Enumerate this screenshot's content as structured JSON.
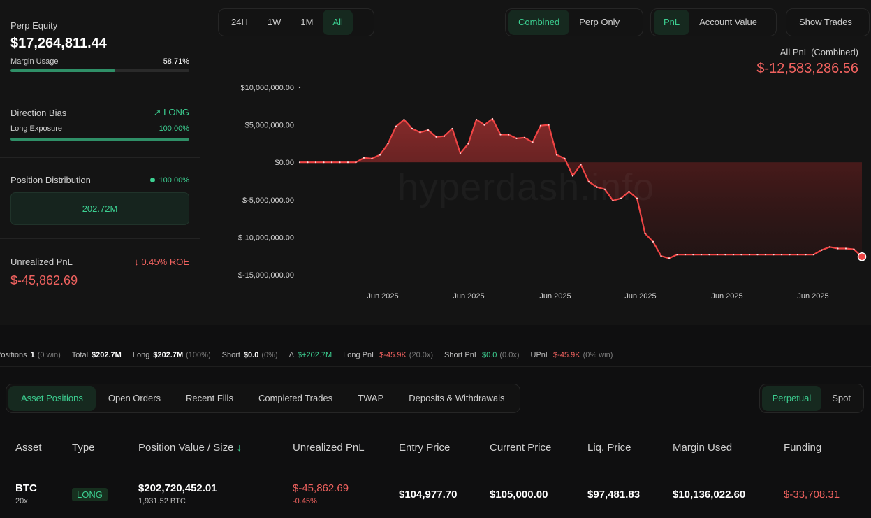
{
  "left": {
    "equity_label": "Perp Equity",
    "equity_value": "$17,264,811.44",
    "margin_label": "Margin Usage",
    "margin_value": "58.71%",
    "margin_fraction": 0.5871,
    "bias_label": "Direction Bias",
    "bias_value": "LONG",
    "long_exposure_label": "Long Exposure",
    "long_exposure_value": "100.00%",
    "long_exposure_fraction": 1.0,
    "dist_label": "Position Distribution",
    "dist_pct": "100.00%",
    "dist_box": "202.72M",
    "upnl_label": "Unrealized PnL",
    "upnl_roe": "0.45% ROE",
    "upnl_value": "$-45,862.69"
  },
  "timeframes": [
    "24H",
    "1W",
    "1M",
    "All"
  ],
  "timeframe_active": "All",
  "modes": [
    "Combined",
    "Perp Only"
  ],
  "mode_active": "Combined",
  "metrics": [
    "PnL",
    "Account Value"
  ],
  "metric_active": "PnL",
  "show_trades": "Show Trades",
  "pnl_header": {
    "title": "All PnL (Combined)",
    "value": "$-12,583,286.56"
  },
  "watermark": "hyperdash.info",
  "chart_data": {
    "type": "area",
    "title": "",
    "y_tick_labels": [
      "$10,000,000.00",
      "$5,000,000.00",
      "$0.00",
      "$-5,000,000.00",
      "$-10,000,000.00",
      "$-15,000,000.00"
    ],
    "y_ticks": [
      10000000,
      5000000,
      0,
      -5000000,
      -10000000,
      -15000000
    ],
    "ylim": [
      -15000000,
      10000000
    ],
    "x_tick_labels": [
      "Jun 2025",
      "Jun 2025",
      "Jun 2025",
      "Jun 2025",
      "Jun 2025",
      "Jun 2025"
    ],
    "series": [
      {
        "values": [
          0,
          0,
          0,
          0,
          0,
          0,
          0,
          0,
          600000,
          500000,
          1000000,
          2500000,
          4800000,
          5700000,
          4500000,
          4000000,
          4300000,
          3400000,
          3500000,
          4500000,
          1200000,
          2500000,
          5700000,
          5000000,
          5800000,
          3700000,
          3700000,
          3200000,
          3300000,
          2700000,
          4900000,
          5000000,
          1000000,
          500000,
          -1800000,
          -300000,
          -2600000,
          -3300000,
          -3600000,
          -5100000,
          -4800000,
          -3900000,
          -4800000,
          -9500000,
          -10600000,
          -12500000,
          -12800000,
          -12300000,
          -12300000,
          -12300000,
          -12300000,
          -12300000,
          -12300000,
          -12300000,
          -12300000,
          -12300000,
          -12300000,
          -12300000,
          -12300000,
          -12300000,
          -12300000,
          -12300000,
          -12300000,
          -12300000,
          -12300000,
          -11700000,
          -11300000,
          -11500000,
          -11500000,
          -11600000,
          -12600000
        ]
      }
    ]
  },
  "summary": {
    "positions_label": "Positions",
    "positions_value": "1",
    "positions_note": "(0 win)",
    "total_label": "Total",
    "total_value": "$202.7M",
    "long_label": "Long",
    "long_value": "$202.7M",
    "long_note": "(100%)",
    "short_label": "Short",
    "short_value": "$0.0",
    "short_note": "(0%)",
    "delta_label": "Δ",
    "delta_value": "$+202.7M",
    "long_pnl_label": "Long PnL",
    "long_pnl_value": "$-45.9K",
    "long_pnl_note": "(20.0x)",
    "short_pnl_label": "Short PnL",
    "short_pnl_value": "$0.0",
    "short_pnl_note": "(0.0x)",
    "upnl_label": "UPnL",
    "upnl_value": "$-45.9K",
    "upnl_note": "(0% win)"
  },
  "tabs": [
    "Asset Positions",
    "Open Orders",
    "Recent Fills",
    "Completed Trades",
    "TWAP",
    "Deposits & Withdrawals"
  ],
  "tab_active": "Asset Positions",
  "market_tabs": [
    "Perpetual",
    "Spot"
  ],
  "market_active": "Perpetual",
  "table": {
    "headers": [
      "Asset",
      "Type",
      "Position Value / Size",
      "Unrealized PnL",
      "Entry Price",
      "Current Price",
      "Liq. Price",
      "Margin Used",
      "Funding"
    ],
    "sort_icon": "arrow-down-icon",
    "row": {
      "asset": "BTC",
      "leverage": "20x",
      "type": "LONG",
      "value": "$202,720,452.01",
      "size": "1,931.52 BTC",
      "upnl": "$-45,862.69",
      "upnl_pct": "-0.45%",
      "entry": "$104,977.70",
      "current": "$105,000.00",
      "liq": "$97,481.83",
      "margin": "$10,136,022.60",
      "funding": "$-33,708.31"
    }
  },
  "colors": {
    "accent": "#3ccf91",
    "negative": "#f0625f",
    "line": "#ef4444"
  }
}
